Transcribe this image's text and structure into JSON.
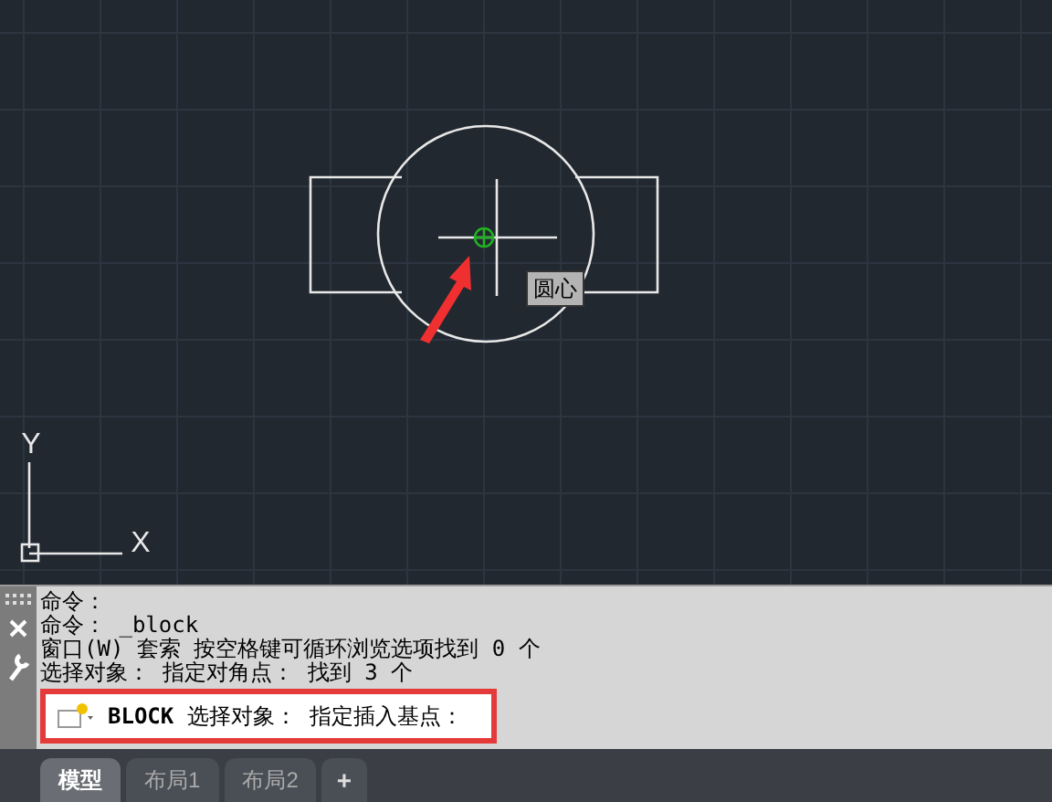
{
  "canvas": {
    "tooltip": "圆心",
    "axis_y_label": "Y",
    "axis_x_label": "X"
  },
  "command_history": [
    "命令：",
    "命令： _block",
    "窗口(W) 套索  按空格键可循环浏览选项找到 0 个",
    "选择对象： 指定对角点： 找到 3 个"
  ],
  "command_line": {
    "command": "BLOCK",
    "prompt": "选择对象：  指定插入基点："
  },
  "tabs": [
    {
      "label": "模型",
      "selected": true
    },
    {
      "label": "布局1",
      "selected": false
    },
    {
      "label": "布局2",
      "selected": false
    }
  ],
  "add_tab_button": "+"
}
